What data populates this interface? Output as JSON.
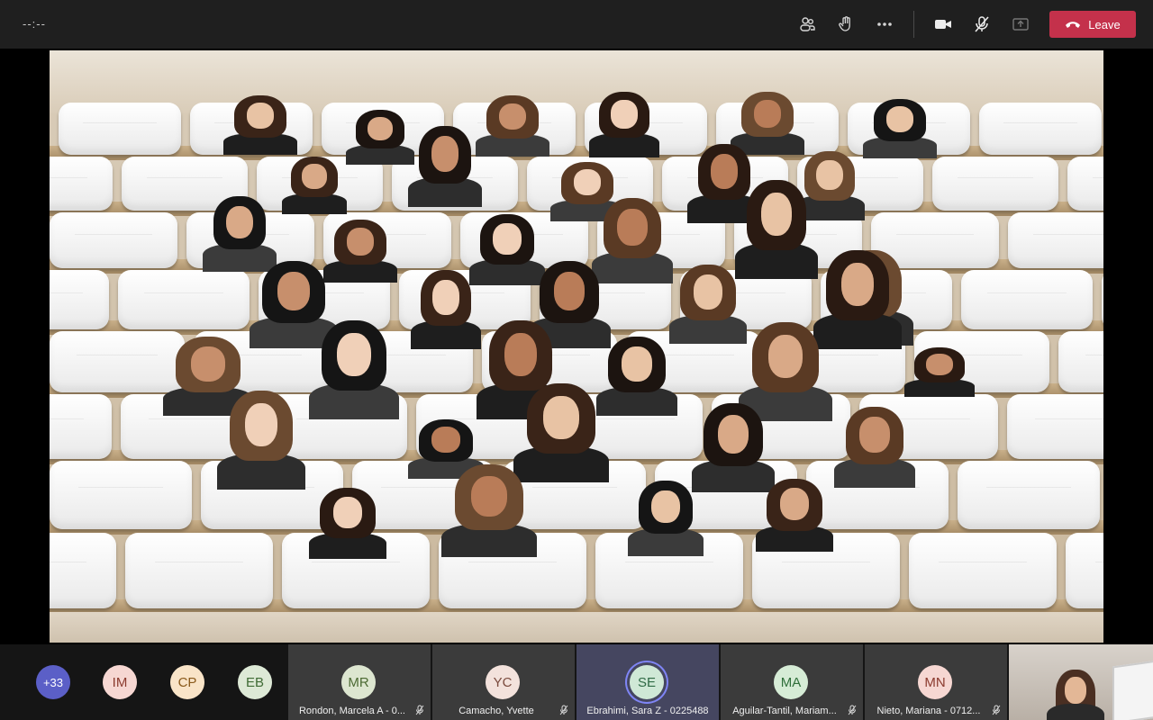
{
  "meeting": {
    "timer": "--:--",
    "leave_label": "Leave"
  },
  "toolbar": {
    "icons": [
      "participants-icon",
      "raise-hand-icon",
      "more-options-icon",
      "camera-icon",
      "mic-muted-icon",
      "share-screen-icon",
      "phone-hangup-icon"
    ]
  },
  "colors": {
    "leave_button": "#c4314b",
    "active_speaker_ring": "#7f85f5",
    "tile_bg": "#3b3b3b",
    "active_tile_bg": "#454660"
  },
  "overflow": {
    "more_count": "+33"
  },
  "avatars": [
    {
      "initials": "IM",
      "bg": "#f6d7d2",
      "fg": "#8b3a2e"
    },
    {
      "initials": "CP",
      "bg": "#f9e4c8",
      "fg": "#8a5a1c"
    },
    {
      "initials": "EB",
      "bg": "#dde9d6",
      "fg": "#3f6b35"
    }
  ],
  "participants": [
    {
      "initials": "MR",
      "name": "Rondon, Marcela A - 0...",
      "bg": "#dde6d0",
      "fg": "#4c6a33",
      "muted": true,
      "active": false
    },
    {
      "initials": "YC",
      "name": "Camacho, Yvette",
      "bg": "#f3e2dc",
      "fg": "#7b4b3e",
      "muted": true,
      "active": false
    },
    {
      "initials": "SE",
      "name": "Ebrahimi, Sara Z - 0225488",
      "bg": "#cfe8d6",
      "fg": "#2f6a45",
      "muted": false,
      "active": true
    },
    {
      "initials": "MA",
      "name": "Aguilar-Tantil, Mariam...",
      "bg": "#d6ecd6",
      "fg": "#2f6f3a",
      "muted": true,
      "active": false
    },
    {
      "initials": "MN",
      "name": "Nieto, Mariana - 0712...",
      "bg": "#f6d7d2",
      "fg": "#8b3a2e",
      "muted": true,
      "active": false
    }
  ],
  "together_mode": {
    "scene": "auditorium",
    "seated_people_count": 37
  }
}
